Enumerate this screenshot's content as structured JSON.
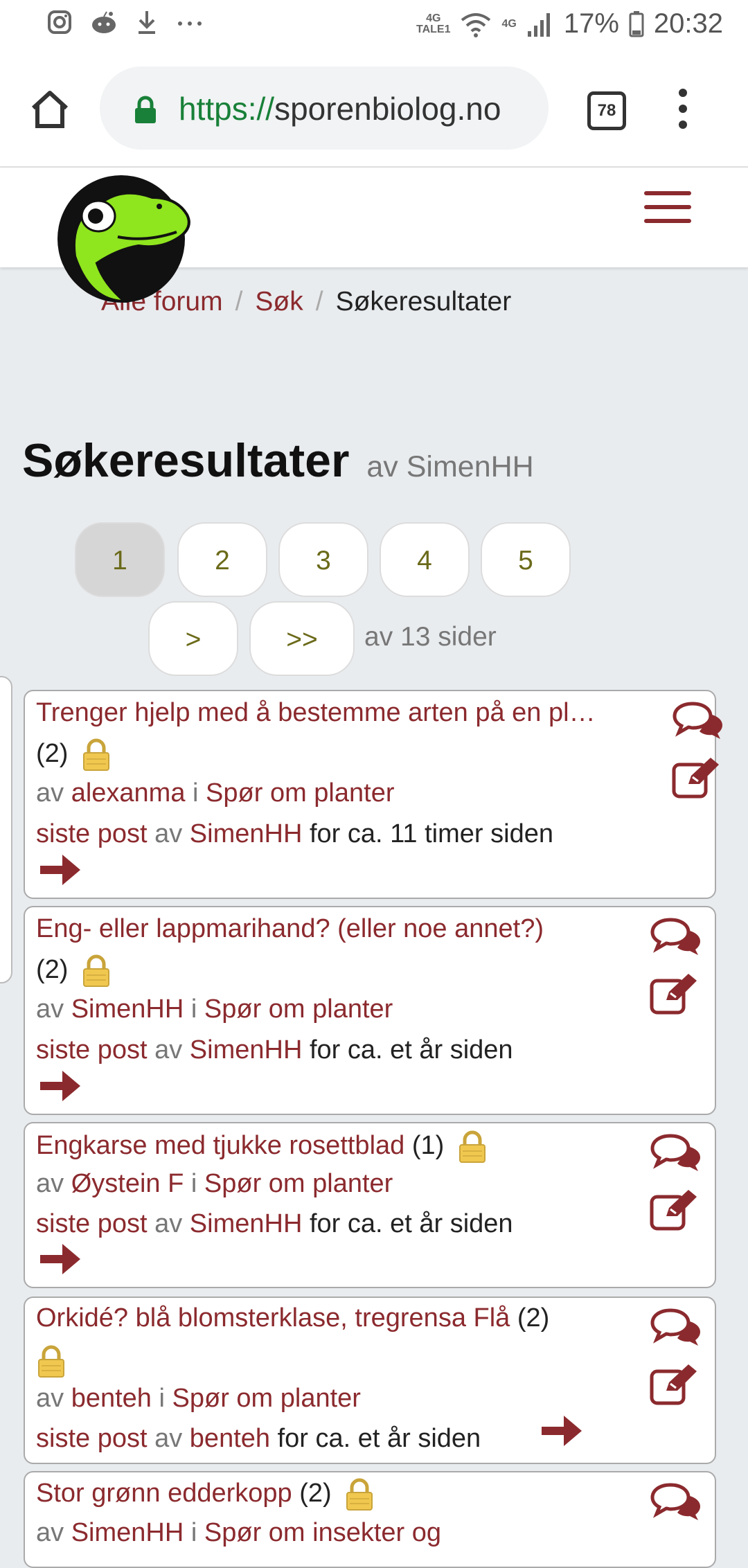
{
  "status_bar": {
    "network_top": "4G",
    "network_bottom": "TALE1",
    "network2": "4G",
    "battery": "17%",
    "time": "20:32"
  },
  "browser": {
    "url_scheme": "https://",
    "url_host": "sporenbiolog.no",
    "tab_count": "78"
  },
  "breadcrumb": {
    "items": [
      "Alle forum",
      "Søk"
    ],
    "current": "Søkeresultater"
  },
  "page": {
    "title": "Søkeresultater",
    "by": "av SimenHH"
  },
  "pagination": {
    "pages": [
      "1",
      "2",
      "3",
      "4",
      "5"
    ],
    "active": "1",
    "next": ">",
    "last": ">>",
    "summary": "av 13 sider"
  },
  "results": [
    {
      "title": "Trenger hjelp med å bestemme arten på en pl…",
      "count": "(2)",
      "by_word": "av",
      "author": "alexanma",
      "in_word": "i",
      "forum": "Spør om planter",
      "last_post_label": "siste post",
      "last_by_word": "av",
      "last_author": "SimenHH",
      "time": "for ca. 11 timer siden"
    },
    {
      "title": "Eng- eller lappmarihand? (eller noe annet?)",
      "count": "(2)",
      "by_word": "av",
      "author": "SimenHH",
      "in_word": "i",
      "forum": "Spør om planter",
      "last_post_label": "siste post",
      "last_by_word": "av",
      "last_author": "SimenHH",
      "time": "for ca. et år siden"
    },
    {
      "title": "Engkarse med tjukke rosettblad",
      "count": "(1)",
      "by_word": "av",
      "author": "Øystein F",
      "in_word": "i",
      "forum": "Spør om planter",
      "last_post_label": "siste post",
      "last_by_word": "av",
      "last_author": "SimenHH",
      "time": "for ca. et år siden"
    },
    {
      "title": "Orkidé? blå blomsterklase, tregrensa Flå",
      "count": "(2)",
      "by_word": "av",
      "author": "benteh",
      "in_word": "i",
      "forum": "Spør om planter",
      "last_post_label": "siste post",
      "last_by_word": "av",
      "last_author": "benteh",
      "time": "for ca. et år siden"
    },
    {
      "title": "Stor grønn edderkopp",
      "count": "(2)",
      "by_word": "av",
      "author": "SimenHH",
      "in_word": "i",
      "forum": "Spør om insekter og"
    }
  ],
  "colors": {
    "link": "#8b2a2e",
    "page_link": "#6b6a1a",
    "background": "#e9ecef",
    "secure_green": "#188038"
  },
  "icons": [
    "instagram-icon",
    "reddit-icon",
    "download-icon",
    "more-icon",
    "wifi-icon",
    "signal-icon",
    "battery-icon",
    "home-icon",
    "lock-icon",
    "tabs-icon",
    "menu-icon",
    "frog-logo",
    "hamburger-icon",
    "chat-icon",
    "edit-icon",
    "arrow-right-icon",
    "padlock-icon"
  ]
}
